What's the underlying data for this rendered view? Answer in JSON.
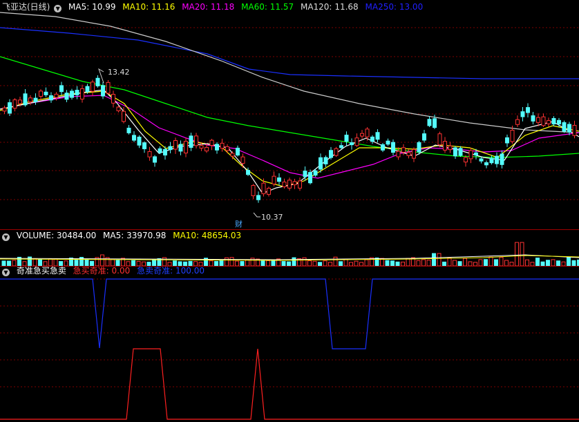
{
  "main": {
    "title": "飞亚达(日线)",
    "ma": [
      {
        "label": "MA5:",
        "value": "10.99",
        "color": "#ffffff"
      },
      {
        "label": "MA10:",
        "value": "11.16",
        "color": "#ffff00"
      },
      {
        "label": "MA20:",
        "value": "11.18",
        "color": "#ff00ff"
      },
      {
        "label": "MA60:",
        "value": "11.57",
        "color": "#00ff00"
      },
      {
        "label": "MA120:",
        "value": "11.68",
        "color": "#dddddd"
      },
      {
        "label": "MA250:",
        "value": "13.00",
        "color": "#0000ff"
      }
    ],
    "high_label": "13.42",
    "low_label": "10.37",
    "event_marker": "财"
  },
  "volume": {
    "label": "VOLUME:",
    "value": "30484.00",
    "ma5_label": "MA5:",
    "ma5_value": "33970.98",
    "ma10_label": "MA10:",
    "ma10_value": "48654.03"
  },
  "indicator": {
    "title": "奇准急买急卖",
    "buy_label": "急买奇准:",
    "buy_value": "0.00",
    "sell_label": "急卖奇准:",
    "sell_value": "100.00"
  },
  "colors": {
    "up": "#ff3232",
    "down": "#54fcfc",
    "grid": "#800000",
    "sep": "#a00000"
  },
  "icons": [
    "collapse-icon"
  ]
}
